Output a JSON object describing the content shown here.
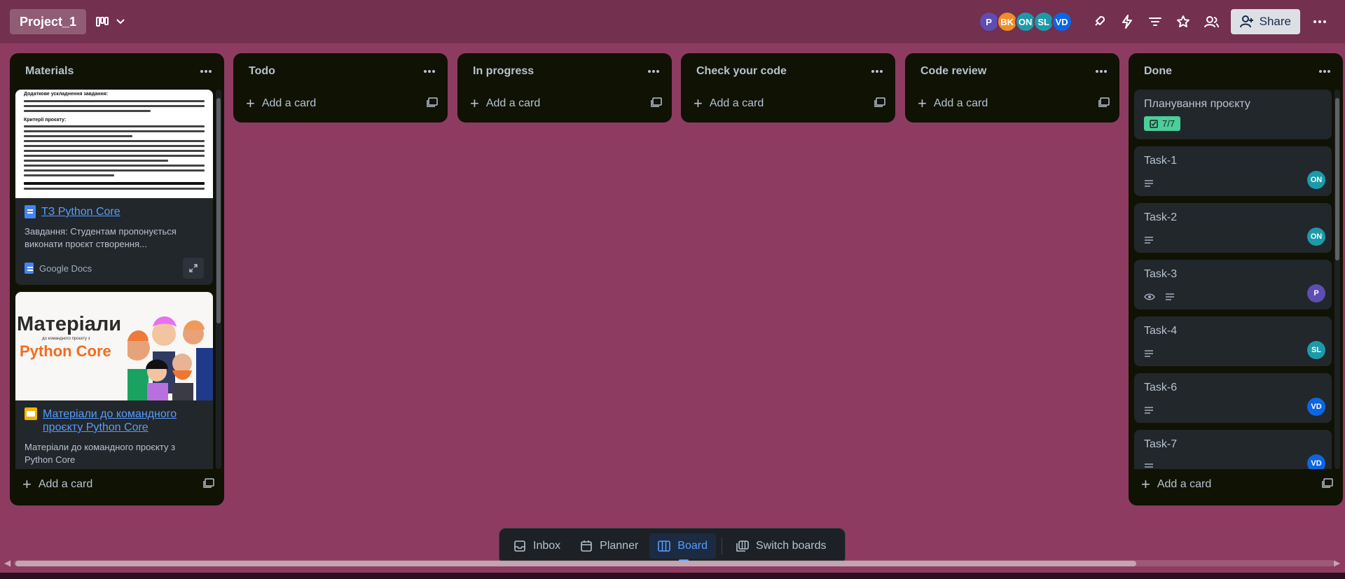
{
  "board": {
    "title": "Project_1",
    "share_label": "Share",
    "members": [
      {
        "initials": "P",
        "color": "#5e4db2"
      },
      {
        "initials": "BK",
        "color": "#f18c2b"
      },
      {
        "initials": "ON",
        "color": "#1d9aaa"
      },
      {
        "initials": "SL",
        "color": "#1d9aaa"
      },
      {
        "initials": "VD",
        "color": "#0c66e4"
      }
    ],
    "toolbar_icons": [
      "rocket-icon",
      "lightning-icon",
      "filter-icon",
      "star-icon",
      "people-icon",
      "more-icon"
    ]
  },
  "add_card_label": "Add a card",
  "lists": {
    "materials": {
      "title": "Materials",
      "cards": [
        {
          "link": "ТЗ Python Core",
          "description": "Завдання: Студентам пропонується виконати проєкт створення...",
          "source": "Google Docs",
          "preview_heading": "Додаткове ускладнення завдання:",
          "preview_criteria": "Критерії проєкту:"
        },
        {
          "link": "Матеріали до командного проєкту Python Core",
          "description": "Матеріали до командного проєкту з Python Core",
          "slide_title_1": "Матеріали",
          "slide_subtitle": "до командного проєкту з",
          "slide_title_2": "Python Core"
        }
      ]
    },
    "todo": {
      "title": "Todo"
    },
    "in_progress": {
      "title": "In progress"
    },
    "check_code": {
      "title": "Check your code"
    },
    "code_review": {
      "title": "Code review"
    },
    "done": {
      "title": "Done",
      "cards": [
        {
          "title": "Планування проєкту",
          "checklist": "7/7"
        },
        {
          "title": "Task-1",
          "member": "ON",
          "member_color": "#1d9aaa"
        },
        {
          "title": "Task-2",
          "member": "ON",
          "member_color": "#1d9aaa"
        },
        {
          "title": "Task-3",
          "member": "P",
          "member_color": "#5e4db2"
        },
        {
          "title": "Task-4",
          "member": "SL",
          "member_color": "#1d9aaa"
        },
        {
          "title": "Task-6",
          "member": "VD",
          "member_color": "#0c66e4"
        },
        {
          "title": "Task-7",
          "member": "VD",
          "member_color": "#0c66e4"
        }
      ]
    }
  },
  "bottom_nav": {
    "inbox": "Inbox",
    "planner": "Planner",
    "board": "Board",
    "switch_boards": "Switch boards"
  }
}
